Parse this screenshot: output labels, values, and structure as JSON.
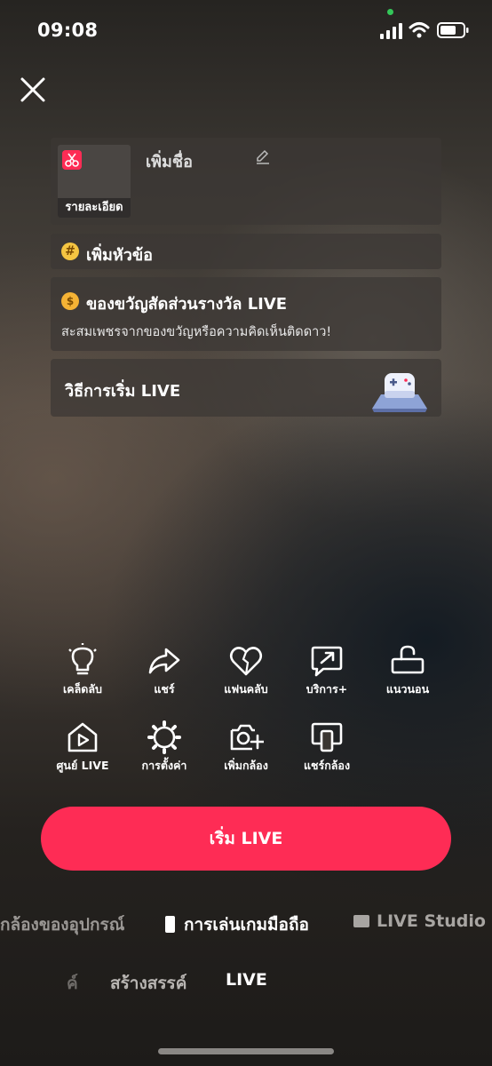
{
  "status_bar": {
    "time": "09:08"
  },
  "setup": {
    "thumbnail_label": "รายละเอียด",
    "add_name": "เพิ่มชื่อ",
    "add_topic": "เพิ่มหัวข้อ",
    "gift": {
      "title": "ของขวัญสัดส่วนรางวัล LIVE",
      "subtitle": "สะสมเพชรจากของขวัญหรือความคิดเห็นติดดาว!"
    },
    "how_to_start": "วิธีการเริ่ม LIVE"
  },
  "tools": [
    {
      "label": "เคล็ดลับ",
      "icon": "lightbulb-icon"
    },
    {
      "label": "แชร์",
      "icon": "share-arrow-icon"
    },
    {
      "label": "แฟนคลับ",
      "icon": "heart-icon"
    },
    {
      "label": "บริการ+",
      "icon": "chat-arrow-icon"
    },
    {
      "label": "แนวนอน",
      "icon": "rotate-lock-icon"
    },
    {
      "label": "ศูนย์ LIVE",
      "icon": "home-play-icon"
    },
    {
      "label": "การตั้งค่า",
      "icon": "gear-icon"
    },
    {
      "label": "เพิ่มกล้อง",
      "icon": "add-camera-icon"
    },
    {
      "label": "แชร์กล้อง",
      "icon": "share-screen-icon"
    }
  ],
  "start_button": "เริ่ม LIVE",
  "modes": {
    "device_camera": "กล้องของอุปกรณ์",
    "mobile_gaming": "การเล่นเกมมือถือ",
    "live_studio": "LIVE Studio"
  },
  "bottom_nav": {
    "faded": "ค์",
    "create": "สร้างสรรค์",
    "live": "LIVE"
  },
  "colors": {
    "accent": "#fe2c55",
    "status_dot": "#34c759"
  }
}
